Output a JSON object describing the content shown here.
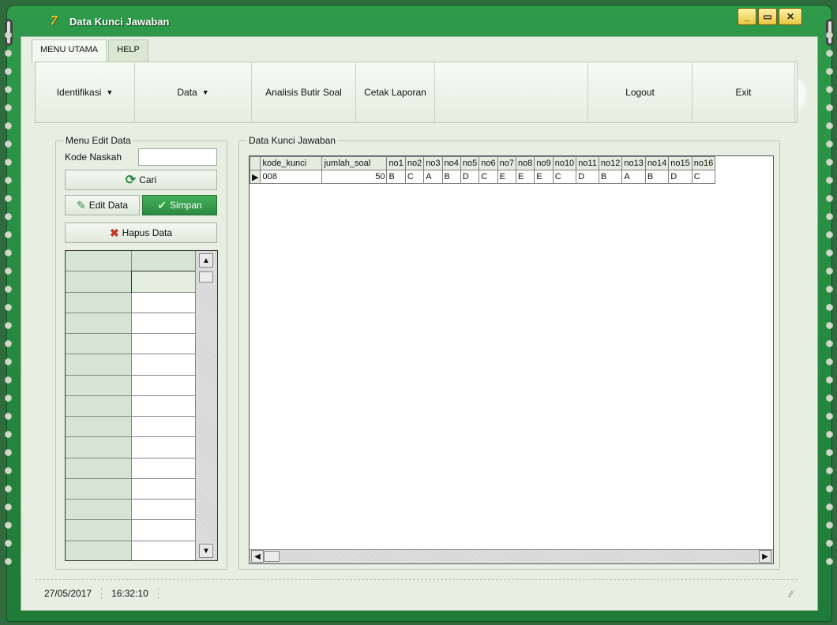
{
  "window": {
    "title": "Data Kunci Jawaban",
    "logo": "7"
  },
  "tabs": [
    {
      "label": "MENU UTAMA"
    },
    {
      "label": "HELP"
    }
  ],
  "ribbon": [
    {
      "label": "Identifikasi",
      "dropdown": true
    },
    {
      "label": "Data",
      "dropdown": true
    },
    {
      "label": "Analisis Butir Soal"
    },
    {
      "label": "Cetak Laporan"
    },
    {
      "label": "Logout"
    },
    {
      "label": "Exit"
    }
  ],
  "edit_panel": {
    "title": "Menu Edit Data",
    "kode_label": "Kode Naskah",
    "kode_value": "",
    "cari_label": "Cari",
    "edit_label": "Edit Data",
    "simpan_label": "Simpan",
    "hapus_label": "Hapus Data"
  },
  "data_panel": {
    "title": "Data Kunci Jawaban",
    "columns": [
      "kode_kunci",
      "jumlah_soal",
      "no1",
      "no2",
      "no3",
      "no4",
      "no5",
      "no6",
      "no7",
      "no8",
      "no9",
      "no10",
      "no11",
      "no12",
      "no13",
      "no14",
      "no15",
      "no16"
    ],
    "rows": [
      [
        "008",
        "50",
        "B",
        "C",
        "A",
        "B",
        "D",
        "C",
        "E",
        "E",
        "E",
        "C",
        "D",
        "B",
        "A",
        "B",
        "D",
        "C"
      ]
    ]
  },
  "status": {
    "date": "27/05/2017",
    "time": "16:32:10"
  },
  "colors": {
    "frame": "#1f7b38",
    "client": "#e7efe2",
    "accent_btn": "#2c8a40"
  }
}
